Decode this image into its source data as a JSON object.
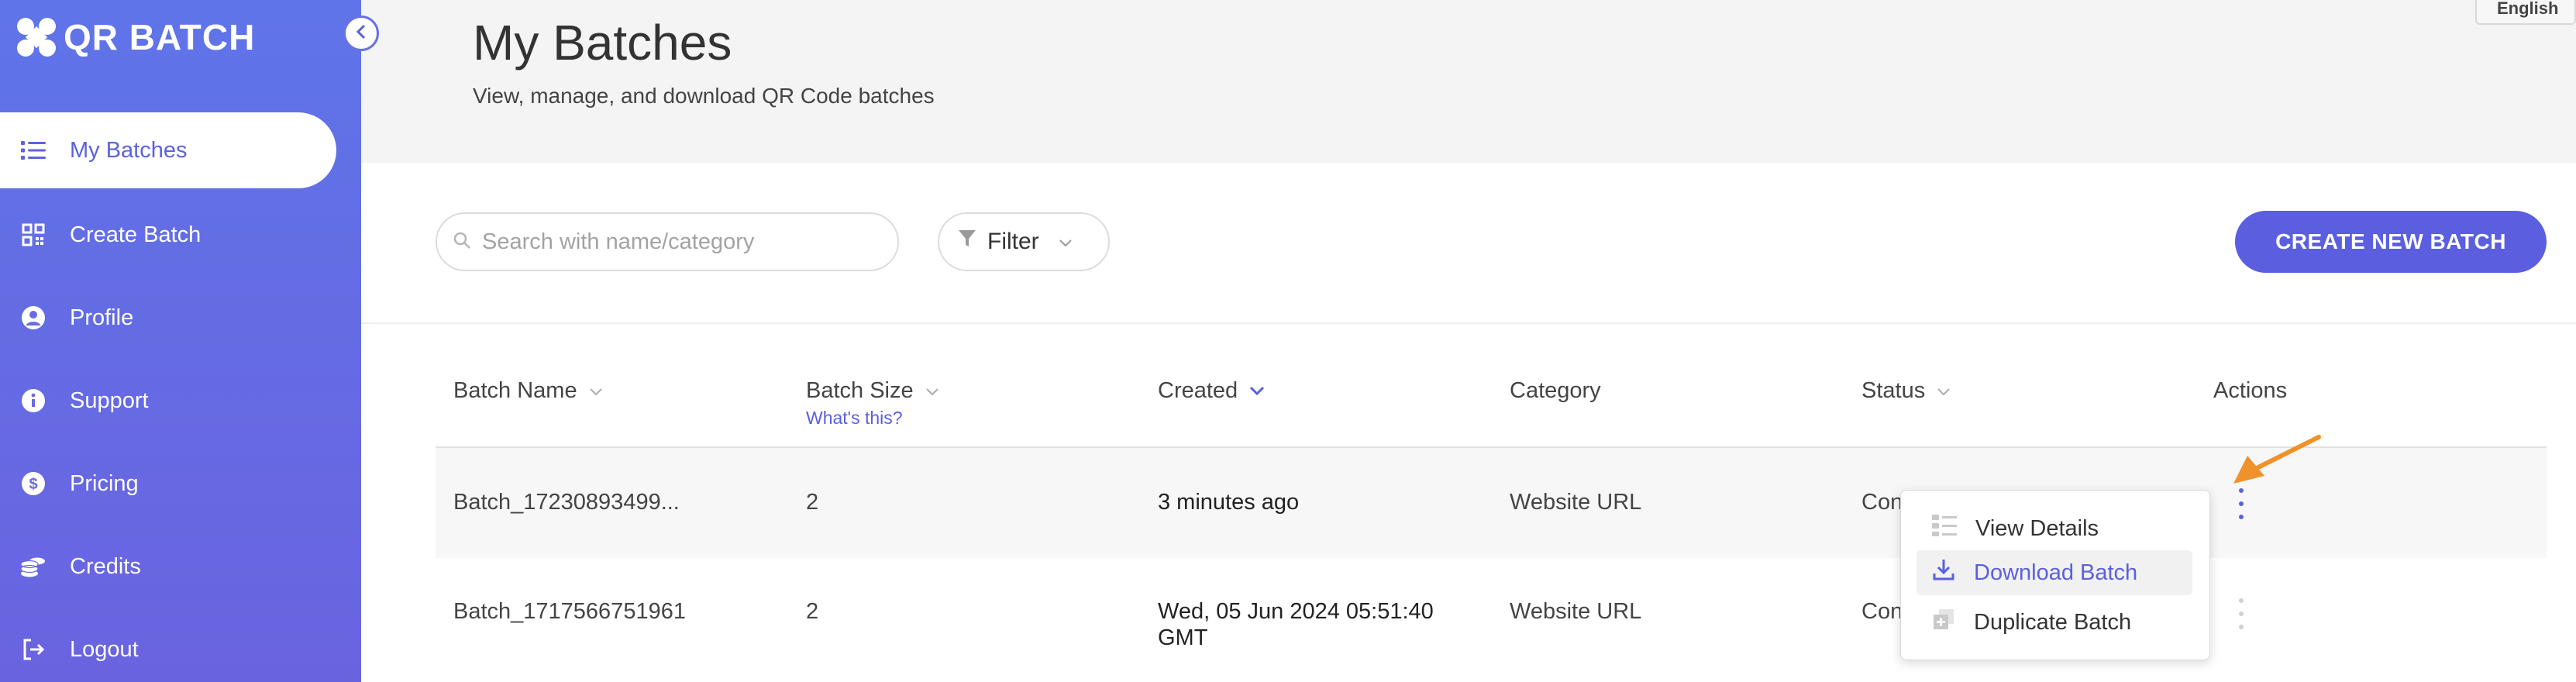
{
  "app": {
    "name": "QR BATCH"
  },
  "colors": {
    "accent": "#5b5fdf",
    "sidebar": "#6a6be4",
    "arrow": "#f0922b"
  },
  "sidebar": {
    "items": [
      {
        "label": "My Batches",
        "icon": "list-icon",
        "active": true
      },
      {
        "label": "Create Batch",
        "icon": "qr-code-icon",
        "active": false
      },
      {
        "label": "Profile",
        "icon": "user-circle-icon",
        "active": false
      },
      {
        "label": "Support",
        "icon": "info-icon",
        "active": false
      },
      {
        "label": "Pricing",
        "icon": "dollar-icon",
        "active": false
      },
      {
        "label": "Credits",
        "icon": "coins-icon",
        "active": false
      },
      {
        "label": "Logout",
        "icon": "logout-icon",
        "active": false
      }
    ]
  },
  "header": {
    "title": "My Batches",
    "subtitle": "View, manage, and download QR Code batches",
    "language": "English"
  },
  "toolbar": {
    "search_placeholder": "Search with name/category",
    "filter_label": "Filter",
    "create_label": "CREATE NEW BATCH"
  },
  "table": {
    "columns": [
      "Batch Name",
      "Batch Size",
      "Created",
      "Category",
      "Status",
      "Actions"
    ],
    "help_link": "What's this?",
    "rows": [
      {
        "name": "Batch_17230893499...",
        "size": "2",
        "created": "3 minutes ago",
        "category": "Website URL",
        "status": "Con"
      },
      {
        "name": "Batch_1717566751961",
        "size": "2",
        "created_line1": "Wed, 05 Jun 2024 05:51:40",
        "created_line2": "GMT",
        "category": "Website URL",
        "status": "Con"
      }
    ]
  },
  "menu": {
    "items": [
      "View Details",
      "Download Batch",
      "Duplicate Batch"
    ]
  }
}
